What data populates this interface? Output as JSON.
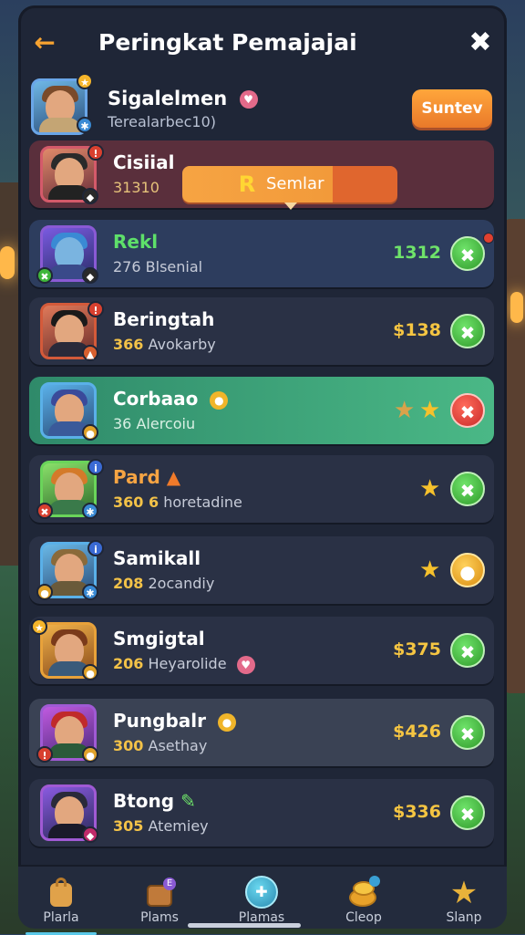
{
  "header": {
    "title": "Peringkat Pemajajai"
  },
  "profile": {
    "name": "Sigalelmen",
    "subtitle": "Terealarbec10)",
    "button_label": "Suntev"
  },
  "tooltip": {
    "label": "Semlar",
    "icon_letter": "R"
  },
  "rows": [
    {
      "name": "Cisiial",
      "num": "",
      "sub": "31310",
      "score": "",
      "action": "none",
      "stars": 0
    },
    {
      "name": "Rekl",
      "num": "276",
      "sub": "Blsenial",
      "score": "1312",
      "action": "green",
      "stars": 0
    },
    {
      "name": "Beringtah",
      "num": "366",
      "sub": "Avokarby",
      "score": "$138",
      "action": "green",
      "stars": 0
    },
    {
      "name": "Corbaao",
      "num": "36",
      "sub": "Alercoiu",
      "score": "",
      "action": "red",
      "stars": 2
    },
    {
      "name": "Pard",
      "num": "360 6",
      "sub": "horetadine",
      "score": "",
      "action": "green",
      "stars": 1
    },
    {
      "name": "Samikall",
      "num": "208",
      "sub": "2ocandiy",
      "score": "",
      "action": "gold",
      "stars": 1
    },
    {
      "name": "Smgigtal",
      "num": "206",
      "sub": "Heyarolide",
      "score": "$375",
      "action": "green",
      "stars": 0
    },
    {
      "name": "Pungbalr",
      "num": "300",
      "sub": "Asethay",
      "score": "$426",
      "action": "green",
      "stars": 0
    },
    {
      "name": "Btong",
      "num": "305",
      "sub": "Atemiey",
      "score": "$336",
      "action": "green",
      "stars": 0
    }
  ],
  "tabs": [
    {
      "label": "Plarla",
      "icon": "bag-icon"
    },
    {
      "label": "Plams",
      "icon": "chest-icon"
    },
    {
      "label": "Plamas",
      "icon": "controller-icon"
    },
    {
      "label": "Cleop",
      "icon": "coins-icon"
    },
    {
      "label": "Slanp",
      "icon": "star-icon"
    }
  ],
  "colors": {
    "accent": "#f7a330",
    "positive": "#3fb63a",
    "negative": "#d93434",
    "gold": "#f5c542",
    "highlight_row": "#3fae7a"
  }
}
